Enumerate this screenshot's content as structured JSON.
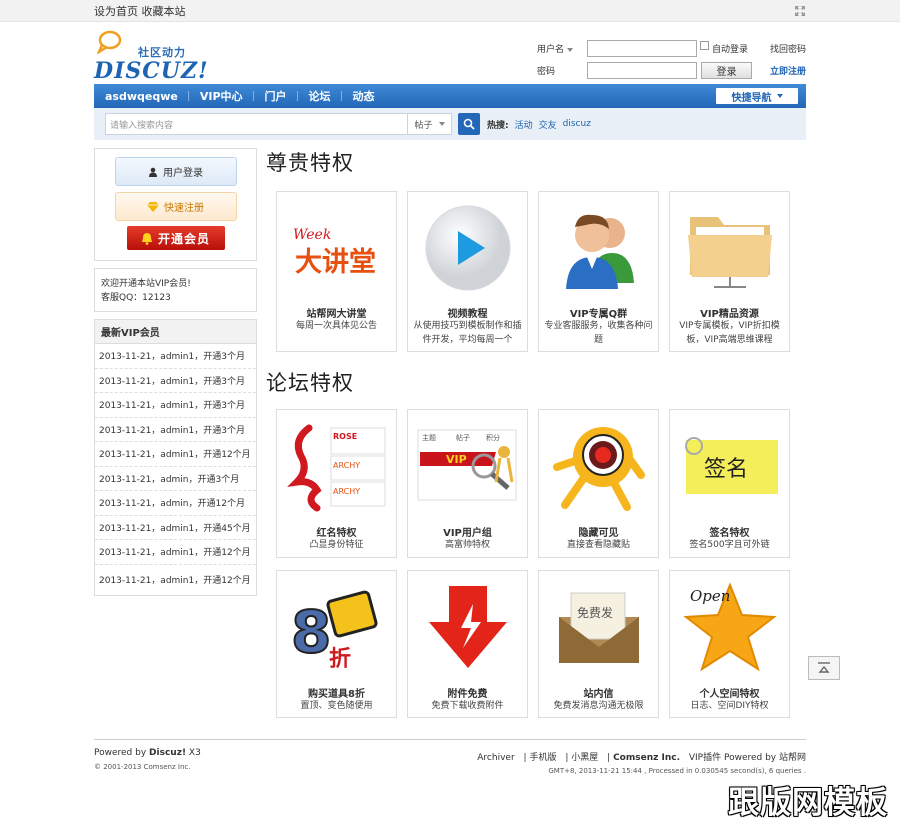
{
  "topbar": {
    "set_home": "设为首页",
    "bookmark": "收藏本站"
  },
  "logo": {
    "slogan": "社区动力",
    "word": "DISCUZ!"
  },
  "login": {
    "username_label": "用户名",
    "password_label": "密码",
    "auto_login": "自动登录",
    "retrieve_password": "找回密码",
    "login_button": "登录",
    "register_now": "立即注册"
  },
  "nav": {
    "items": [
      "asdwqeqwe",
      "VIP中心",
      "门户",
      "论坛",
      "动态"
    ],
    "quick_nav": "快捷导航"
  },
  "search": {
    "placeholder": "请输入搜索内容",
    "type": "帖子",
    "hot_label": "热搜:",
    "hot_words": [
      "活动",
      "交友",
      "discuz"
    ]
  },
  "sidebar": {
    "login_button": "用户登录",
    "register_button": "快速注册",
    "vip_button": "开通会员",
    "welcome_line1": "欢迎开通本站VIP会员!",
    "welcome_line2": "客服QQ：12123",
    "latest_title": "最新VIP会员",
    "latest": [
      "2013-11-21，admin1，开通3个月",
      "2013-11-21，admin1，开通3个月",
      "2013-11-21，admin1，开通3个月",
      "2013-11-21，admin1，开通3个月",
      "2013-11-21，admin1，开通12个月",
      "2013-11-21，admin，开通3个月",
      "2013-11-21，admin，开通12个月",
      "2013-11-21，admin1，开通45个月",
      "2013-11-21，admin1，开通12个月",
      "2013-11-21，admin1，开通12个月"
    ]
  },
  "sections": {
    "premium_title": "尊贵特权",
    "forum_title": "论坛特权"
  },
  "premium": [
    {
      "title": "站帮网大讲堂",
      "desc": "每周一次具体见公告",
      "icon": "lecture-icon"
    },
    {
      "title": "视频教程",
      "desc": "从使用技巧到模板制作和插件开发，平均每周一个",
      "icon": "video-play-icon"
    },
    {
      "title": "VIP专属Q群",
      "desc": "专业客服服务，收集各种问题",
      "icon": "users-icon"
    },
    {
      "title": "VIP精品资源",
      "desc": "VIP专属模板，VIP折扣模板，VIP高端思维课程",
      "icon": "folder-icon"
    }
  ],
  "forum1": [
    {
      "title": "红名特权",
      "desc": "凸显身份特征",
      "icon": "red-name-icon"
    },
    {
      "title": "VIP用户组",
      "desc": "高富帅特权",
      "icon": "vip-group-icon"
    },
    {
      "title": "隐藏可见",
      "desc": "直接查看隐藏贴",
      "icon": "eye-creature-icon"
    },
    {
      "title": "签名特权",
      "desc": "签名500字且可外链",
      "icon": "signature-note-icon"
    }
  ],
  "forum2": [
    {
      "title": "购买道具8折",
      "desc": "置顶、变色随便用",
      "icon": "discount-icon"
    },
    {
      "title": "附件免费",
      "desc": "免费下载收费附件",
      "icon": "download-icon"
    },
    {
      "title": "站内信",
      "desc": "免费发消息沟通无极限",
      "icon": "envelope-icon"
    },
    {
      "title": "个人空间特权",
      "desc": "日志、空间DIY特权",
      "icon": "star-icon"
    }
  ],
  "images_text": {
    "week": "Week",
    "lecture": "大讲堂",
    "rose": "ROSE",
    "archy": "ARCHY",
    "vip": "VIP",
    "zhuti": "主题",
    "tiezi": "帖子",
    "jifen": "积分",
    "eight": "8",
    "zhe": "折",
    "qianming": "签名",
    "mianfeifa": "免费发",
    "open": "Open"
  },
  "footer": {
    "powered_prefix": "Powered by",
    "brand": "Discuz!",
    "version": "X3",
    "copyright": "© 2001-2013 Comsenz Inc.",
    "links": [
      "Archiver",
      "手机版",
      "小黑屋"
    ],
    "company": "Comsenz Inc.",
    "plugin": "VIP插件 Powered by 站帮网",
    "stats": "GMT+8, 2013-11-21 15:44 , Processed in 0.030545 second(s), 6 queries ."
  },
  "watermark": "跟版网模板",
  "colors": {
    "nav_blue": "#2367b8",
    "accent_red": "#d0191f",
    "link_blue": "#1d64b3"
  }
}
